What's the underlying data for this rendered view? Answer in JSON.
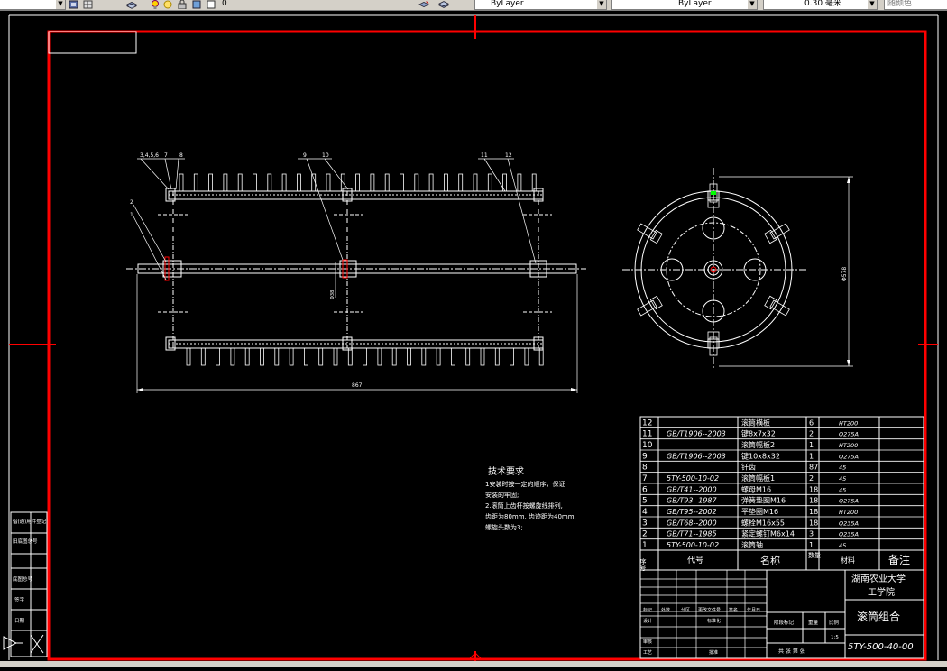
{
  "toolbar": {
    "layer_value": "0",
    "color_value": "ByLayer",
    "linetype_value": "ByLayer",
    "lineweight_value": "0.30 毫米",
    "plotstyle_value": "随颜色"
  },
  "drawing": {
    "front_view": {
      "leader_labels": [
        "3,4,5,6",
        "7",
        "8",
        "2",
        "1",
        "9",
        "10",
        "11",
        "12"
      ],
      "overall_length_dim": "867",
      "local_dim": "Φ38"
    },
    "side_view": {
      "diameter_dim": "Φ578"
    },
    "technical_requirements": {
      "title": "技术要求",
      "lines": [
        "1安装时按一定的顺序，保证",
        "安装的牢固;",
        "2.滚筒上齿杆按螺旋线排列,",
        "齿距为80mm, 齿迹距为40mm,",
        "螺旋头数为3;"
      ]
    },
    "bom": {
      "rows": [
        {
          "no": "12",
          "code": "",
          "name": "滚筒横板",
          "qty": "6",
          "material": "HT200"
        },
        {
          "no": "11",
          "code": "GB/T1906--2003",
          "name": "键8x7x32",
          "qty": "2",
          "material": "Q275A"
        },
        {
          "no": "10",
          "code": "",
          "name": "滚筒幅板2",
          "qty": "1",
          "material": "HT200"
        },
        {
          "no": "9",
          "code": "GB/T1906--2003",
          "name": "键10x8x32",
          "qty": "1",
          "material": "Q275A"
        },
        {
          "no": "8",
          "code": "",
          "name": "钎齿",
          "qty": "87",
          "material": "45"
        },
        {
          "no": "7",
          "code": "5TY-500-10-02",
          "name": "滚筒幅板1",
          "qty": "2",
          "material": "45"
        },
        {
          "no": "6",
          "code": "GB/T41--2000",
          "name": "螺母M16",
          "qty": "18",
          "material": "45"
        },
        {
          "no": "5",
          "code": "GB/T93--1987",
          "name": "弹簧垫圈M16",
          "qty": "18",
          "material": "Q275A"
        },
        {
          "no": "4",
          "code": "GB/T95--2002",
          "name": "平垫圈M16",
          "qty": "18",
          "material": "HT200"
        },
        {
          "no": "3",
          "code": "GB/T68--2000",
          "name": "螺栓M16x55",
          "qty": "18",
          "material": "Q235A"
        },
        {
          "no": "2",
          "code": "GB/T71--1985",
          "name": "紧定螺钉M6x14",
          "qty": "3",
          "material": "Q235A"
        },
        {
          "no": "1",
          "code": "5TY-500-10-02",
          "name": "滚筒轴",
          "qty": "1",
          "material": "45"
        }
      ],
      "header": {
        "no": "序号",
        "code": "代号",
        "name": "名称",
        "qty": "数量",
        "material": "材料",
        "remark": "备注"
      }
    },
    "title_block": {
      "school": "湖南农业大学",
      "college": "工学院",
      "drawing_name": "滚筒组合",
      "drawing_no": "5TY-500-40-00",
      "scale_label": "比例",
      "scale_value": "1:5",
      "weight_label": "重量",
      "stage_label": "阶段标记",
      "sheet_label": "共 张 第 张",
      "row_labels": [
        "标记",
        "处数",
        "分区",
        "更改文件号",
        "签名",
        "年月日"
      ],
      "signers": [
        "设计",
        "标准化",
        "审核",
        "工艺",
        "批准"
      ]
    },
    "side_panel_labels": [
      "借(通)用件登记",
      "旧底图总号",
      "底图总号",
      "签字",
      "日期"
    ]
  }
}
